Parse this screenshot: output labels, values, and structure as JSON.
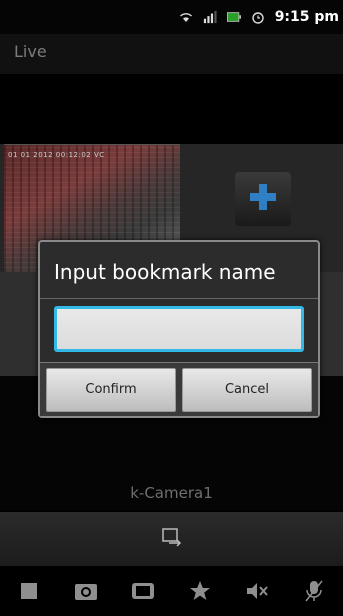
{
  "status_bar": {
    "time": "9:15 pm"
  },
  "header": {
    "title": "Live"
  },
  "camera": {
    "osd_text": "01 01 2012 00:12:02 VC",
    "name": "k-Camera1"
  },
  "dialog": {
    "title": "Input bookmark name",
    "input_value": "",
    "confirm_label": "Confirm",
    "cancel_label": "Cancel",
    "accent_color": "#32b9e6"
  },
  "icons": {
    "add": "plus-icon",
    "switch": "switch-view-icon",
    "toolbar": [
      "stop-icon",
      "snapshot-icon",
      "record-icon",
      "bookmark-star-icon",
      "mute-icon",
      "mic-off-icon"
    ]
  }
}
